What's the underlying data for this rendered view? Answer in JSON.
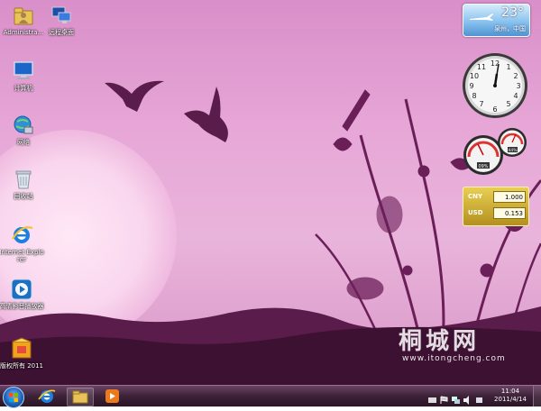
{
  "desktop_icons": [
    {
      "label": "Administra...",
      "icon": "user-folder-icon"
    },
    {
      "label": "远程桌面",
      "icon": "remote-desktop-icon"
    },
    {
      "label": "计算机",
      "icon": "computer-icon"
    },
    {
      "label": "网络",
      "icon": "network-icon"
    },
    {
      "label": "回收站",
      "icon": "recycle-bin-icon"
    },
    {
      "label": "Internet Explorer",
      "icon": "internet-explorer-icon"
    },
    {
      "label": "高清影音播放器",
      "icon": "media-player-icon"
    },
    {
      "label": "版权所有 2011",
      "icon": "software-box-icon"
    }
  ],
  "weather_gadget": {
    "temperature": "23°",
    "city": "泉州，中国"
  },
  "clock_gadget": {
    "time": "11:04"
  },
  "cpu_gadget": {
    "cpu_percent": "09%",
    "memory_percent": "44%"
  },
  "currency_gadget": {
    "rows": [
      {
        "code": "CNY",
        "value": "1.000"
      },
      {
        "code": "USD",
        "value": "0.153"
      }
    ]
  },
  "watermark": {
    "title": "桐城网",
    "url": "www.itongcheng.com"
  },
  "taskbar": {
    "pinned": [
      "internet-explorer-icon",
      "windows-explorer-icon",
      "media-player-icon"
    ],
    "time": "11:04",
    "date": "2011/4/14"
  },
  "colors": {
    "taskbar": "#3d2238",
    "wallpaper": "#e7a8d7",
    "silhouette": "#5a1c4b"
  }
}
